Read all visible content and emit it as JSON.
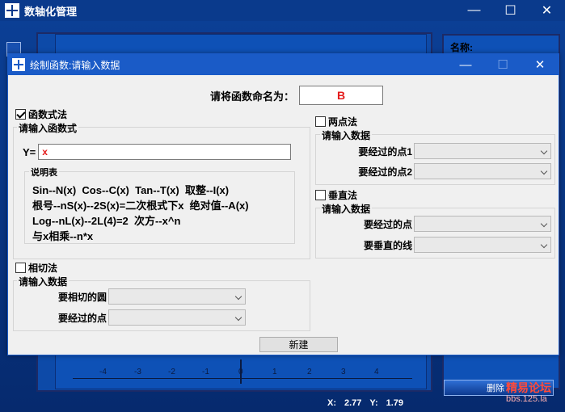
{
  "main_window": {
    "title": "数轴化管理",
    "controls": {
      "minimize": "—",
      "maximize": "☐",
      "close": "✕"
    },
    "side_panel": {
      "name_label": "名称:"
    },
    "axis_ticks": [
      "-4",
      "-3",
      "-2",
      "-1",
      "0",
      "1",
      "2",
      "3",
      "4"
    ],
    "delete_button": "删除",
    "watermark": {
      "line1": "精易论坛",
      "line2": "bbs.125.la"
    },
    "status": {
      "x_label": "X:",
      "x_value": "2.77",
      "y_label": "Y:",
      "y_value": "1.79"
    }
  },
  "dialog": {
    "title": "绘制函数:请输入数据",
    "controls": {
      "minimize": "—",
      "maximize": "☐",
      "close": "✕"
    },
    "name_label": "请将函数命名为：",
    "name_value": "B",
    "func_method": {
      "checkbox_label": "函数式法",
      "checked": true,
      "group_title": "请输入函数式",
      "y_label": "Y=",
      "y_value": "x",
      "legend_title": "说明表",
      "legend_lines": [
        "Sin--N(x)  Cos--C(x)  Tan--T(x)  取整--I(x)",
        "根号--nS(x)--2S(x)=二次根式下x  绝对值--A(x)",
        "Log--nL(x)--2L(4)=2  次方--x^n",
        "与x相乘--n*x"
      ]
    },
    "tangent_method": {
      "checkbox_label": "相切法",
      "checked": false,
      "group_title": "请输入数据",
      "circle_label": "要相切的圆",
      "point_label": "要经过的点"
    },
    "two_point_method": {
      "checkbox_label": "两点法",
      "checked": false,
      "group_title": "请输入数据",
      "point1_label": "要经过的点1",
      "point2_label": "要经过的点2"
    },
    "perpendicular_method": {
      "checkbox_label": "垂直法",
      "checked": false,
      "group_title": "请输入数据",
      "point_label": "要经过的点",
      "line_label": "要垂直的线"
    },
    "new_button": "新建"
  },
  "colors": {
    "title_bar": "#0a3a8c",
    "dialog_title": "#1a5bc7",
    "input_text": "#e41b1b",
    "watermark": "#ff4a3a"
  },
  "icons": {
    "app": "axis-cross-icon",
    "chevron": "chevron-down-icon"
  }
}
